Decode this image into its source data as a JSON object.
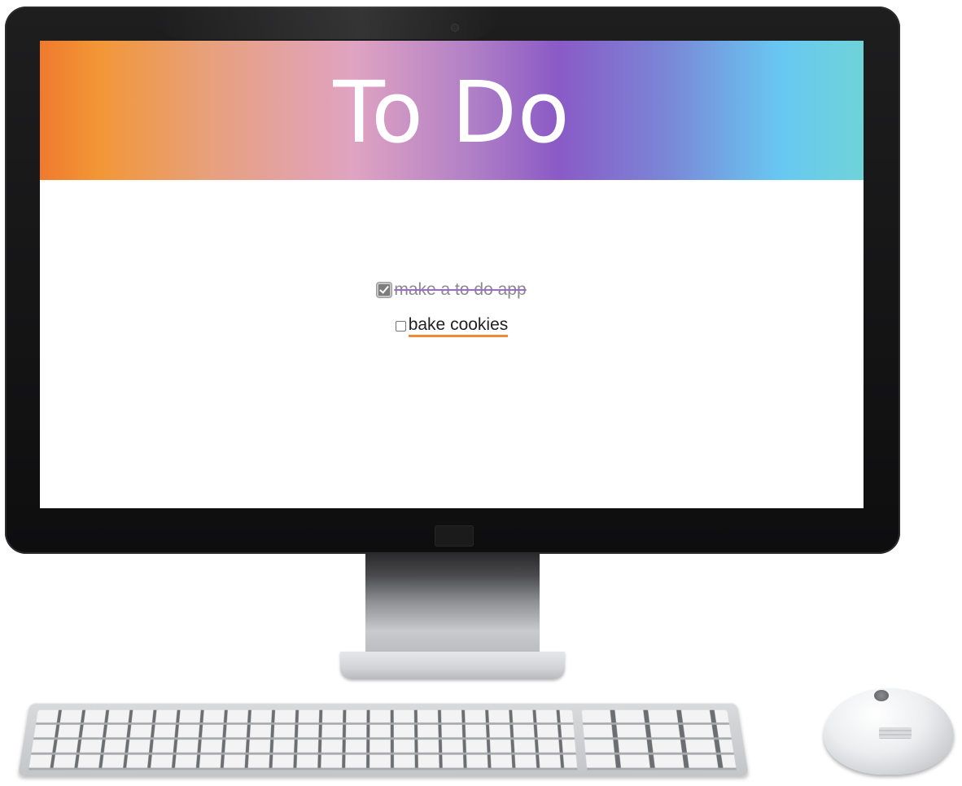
{
  "app": {
    "title": "To Do"
  },
  "todos": [
    {
      "text": "make a to do app",
      "completed": true
    },
    {
      "text": "bake cookies",
      "completed": false
    }
  ],
  "colors": {
    "header_gradient": [
      "#ef7a2e",
      "#f29636",
      "#e0a3c2",
      "#8a5ac6",
      "#68c8f2",
      "#6fd3d8"
    ],
    "completed_strike": "#9c6ad1",
    "active_underline": "#f08a35",
    "bezel": "#141415"
  },
  "icons": {
    "checked": "checkbox-checked-icon",
    "unchecked": "checkbox-unchecked-icon"
  }
}
